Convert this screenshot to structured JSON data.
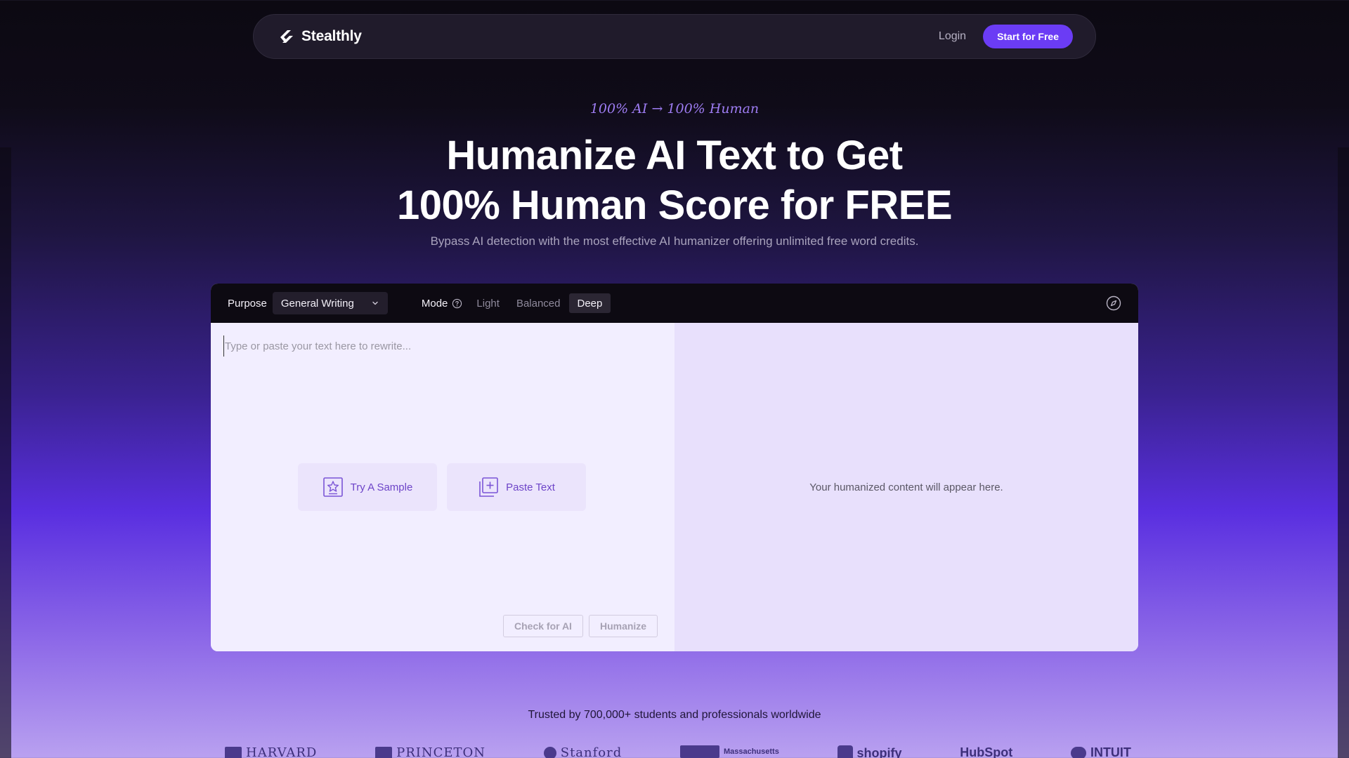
{
  "nav": {
    "brand": "Stealthly",
    "login": "Login",
    "cta": "Start for Free"
  },
  "hero": {
    "eyebrow": "100% AI → 100% Human",
    "title_line1": "Humanize AI Text to Get",
    "title_line2": "100% Human Score for FREE",
    "subtitle": "Bypass AI detection with the most effective AI humanizer offering unlimited free word credits."
  },
  "toolbar": {
    "purpose_label": "Purpose",
    "purpose_value": "General Writing",
    "mode_label": "Mode",
    "modes": [
      "Light",
      "Balanced",
      "Deep"
    ],
    "active_mode": "Deep"
  },
  "editor": {
    "placeholder": "Type or paste your text here to rewrite...",
    "try_sample": "Try A Sample",
    "paste_text": "Paste Text",
    "check_ai": "Check for AI",
    "humanize": "Humanize",
    "output_placeholder": "Your humanized content will appear here."
  },
  "trust": {
    "text": "Trusted by 700,000+ students and professionals worldwide",
    "logos": [
      "HARVARD",
      "PRINCETON",
      "Stanford",
      "Massachusetts",
      "shopify",
      "HubSpot",
      "INTUIT"
    ]
  },
  "colors": {
    "accent": "#6b3cf5",
    "dark": "#0d0a12",
    "editor_bg": "#f2eeff"
  }
}
